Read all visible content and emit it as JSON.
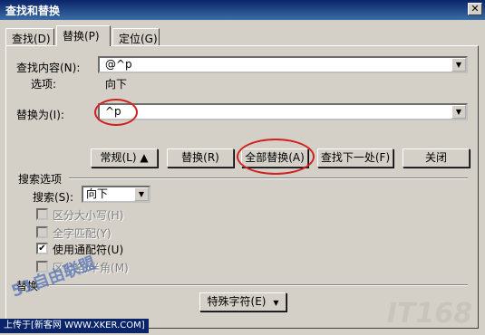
{
  "window": {
    "title": "查找和替换",
    "close_glyph": "✕"
  },
  "tabs": [
    {
      "label": "查找(D)"
    },
    {
      "label": "替换(P)"
    },
    {
      "label": "定位(G)"
    }
  ],
  "find": {
    "label": "查找内容(N):",
    "value": "@^p",
    "options_label": "选项:",
    "options_value": "向下"
  },
  "replace": {
    "label": "替换为(I):",
    "value": "^p"
  },
  "buttons": {
    "less": "常规(L) ▲",
    "replace": "替换(R)",
    "replace_all": "全部替换(A)",
    "find_next": "查找下一处(F)",
    "close": "关闭"
  },
  "search_options": {
    "group_label": "搜索选项",
    "search_label": "搜索(S):",
    "search_value": "向下",
    "match_case": "区分大小写(H)",
    "whole_word": "全字匹配(Y)",
    "wildcards": "使用通配符(U)",
    "full_half": "区分全/半角(M)"
  },
  "replace_section": {
    "label": "替换",
    "special_button": "特殊字符(E)"
  },
  "watermarks": {
    "status_text": "上传于[新客网 WWW.XKER.COM]",
    "brand": "IT168",
    "logo": "51自由联盟"
  },
  "colors": {
    "title_bar": "#0a246a",
    "dialog_bg": "#d4d0c8",
    "highlight_circle": "#d02020"
  }
}
